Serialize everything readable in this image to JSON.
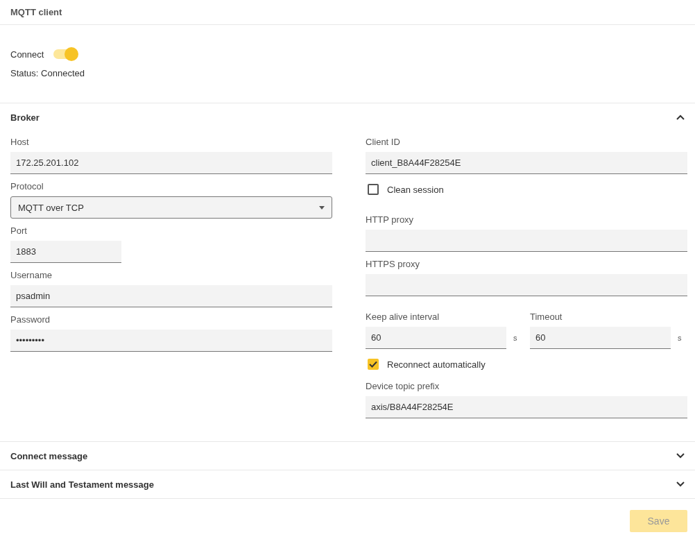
{
  "header": {
    "title": "MQTT client"
  },
  "connection": {
    "label": "Connect",
    "on": true,
    "status": "Status: Connected"
  },
  "broker": {
    "title": "Broker",
    "expanded": true,
    "left": [
      {
        "kind": "text",
        "label": "Host",
        "value": "172.25.201.102"
      },
      {
        "kind": "select",
        "label": "Protocol",
        "value": "MQTT over TCP"
      },
      {
        "kind": "short",
        "label": "Port",
        "value": "1883"
      },
      {
        "kind": "text",
        "label": "Username",
        "value": "psadmin"
      },
      {
        "kind": "text",
        "label": "Password",
        "value": "•••••••••"
      }
    ],
    "right": [
      {
        "kind": "text",
        "label": "Client ID",
        "value": "client_B8A44F28254E"
      },
      {
        "kind": "checkbox",
        "label": "Clean session",
        "checked": false
      },
      {
        "kind": "text",
        "label": "HTTP proxy"
      },
      {
        "kind": "text",
        "label": "HTTPS proxy"
      },
      {
        "kind": "pair",
        "fields": [
          {
            "label": "Keep alive interval",
            "value": "60",
            "unit": "s"
          },
          {
            "label": "Timeout",
            "value": "60",
            "unit": "s"
          }
        ]
      },
      {
        "kind": "checkbox",
        "label": "Reconnect automatically",
        "checked": true
      },
      {
        "kind": "text",
        "label": "Device topic prefix",
        "value": "axis/B8A44F28254E"
      }
    ]
  },
  "sections": [
    {
      "title": "Connect message",
      "expanded": false
    },
    {
      "title": "Last Will and Testament message",
      "expanded": false
    }
  ],
  "save": {
    "label": "Save",
    "disabled": true
  }
}
